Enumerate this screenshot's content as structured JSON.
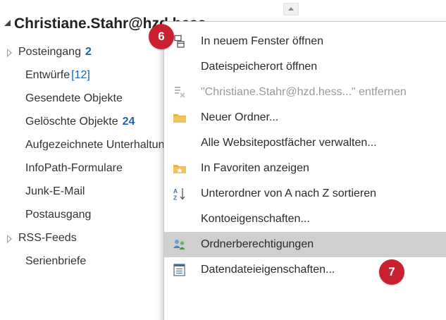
{
  "folder_pane": {
    "account_name": "Christiane.Stahr@hzd.hess...",
    "folders": [
      {
        "label": "Posteingang",
        "count": "2",
        "count_style": "bold",
        "expandable": true
      },
      {
        "label": "Entwürfe",
        "count": "[12]",
        "count_style": "plain",
        "expandable": false
      },
      {
        "label": "Gesendete Objekte",
        "count": "",
        "count_style": "",
        "expandable": false
      },
      {
        "label": "Gelöschte Objekte",
        "count": "24",
        "count_style": "bold",
        "expandable": false
      },
      {
        "label": "Aufgezeichnete Unterhaltungen",
        "count": "",
        "count_style": "",
        "expandable": false
      },
      {
        "label": "InfoPath-Formulare",
        "count": "",
        "count_style": "",
        "expandable": false
      },
      {
        "label": "Junk-E-Mail",
        "count": "",
        "count_style": "",
        "expandable": false
      },
      {
        "label": "Postausgang",
        "count": "",
        "count_style": "",
        "expandable": false
      },
      {
        "label": "RSS-Feeds",
        "count": "",
        "count_style": "",
        "expandable": true
      },
      {
        "label": "Serienbriefe",
        "count": "",
        "count_style": "",
        "expandable": false
      }
    ]
  },
  "context_menu": {
    "items": [
      {
        "label": "In neuem Fenster öffnen",
        "icon": "new-window-icon",
        "disabled": false,
        "highlighted": false
      },
      {
        "label": "Dateispeicherort öffnen",
        "icon": "",
        "disabled": false,
        "highlighted": false
      },
      {
        "label": "\"Christiane.Stahr@hzd.hess...\" entfernen",
        "icon": "remove-account-icon",
        "disabled": true,
        "highlighted": false
      },
      {
        "label": "Neuer Ordner...",
        "icon": "folder-icon",
        "disabled": false,
        "highlighted": false
      },
      {
        "label": "Alle Websitepostfächer verwalten...",
        "icon": "",
        "disabled": false,
        "highlighted": false
      },
      {
        "label": "In Favoriten anzeigen",
        "icon": "favorites-folder-icon",
        "disabled": false,
        "highlighted": false
      },
      {
        "label": "Unterordner von A nach Z sortieren",
        "icon": "sort-az-icon",
        "disabled": false,
        "highlighted": false
      },
      {
        "label": "Kontoeigenschaften...",
        "icon": "",
        "disabled": false,
        "highlighted": false
      },
      {
        "label": "Ordnerberechtigungen",
        "icon": "permissions-icon",
        "disabled": false,
        "highlighted": true
      },
      {
        "label": "Datendateieigenschaften...",
        "icon": "properties-icon",
        "disabled": false,
        "highlighted": false
      }
    ]
  },
  "badges": {
    "step_6": "6",
    "step_7": "7"
  },
  "colors": {
    "badge": "#c8202e",
    "count_blue": "#1a63b5",
    "highlight": "#cfcfcf"
  }
}
